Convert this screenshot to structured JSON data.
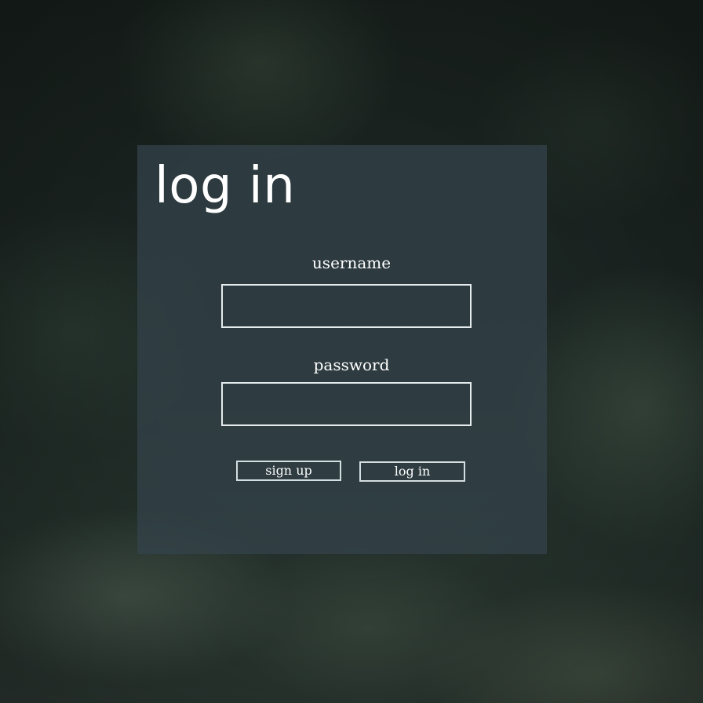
{
  "page": {
    "background": "dark forest"
  },
  "login_form": {
    "title": "log in",
    "username_label": "username",
    "username_value": "",
    "password_label": "password",
    "password_value": "",
    "signup_button_label": "sign up",
    "login_button_label": "log in"
  },
  "colors": {
    "panel_background": "#34444c",
    "field_border": "#e6ecee",
    "text": "#ffffff"
  }
}
